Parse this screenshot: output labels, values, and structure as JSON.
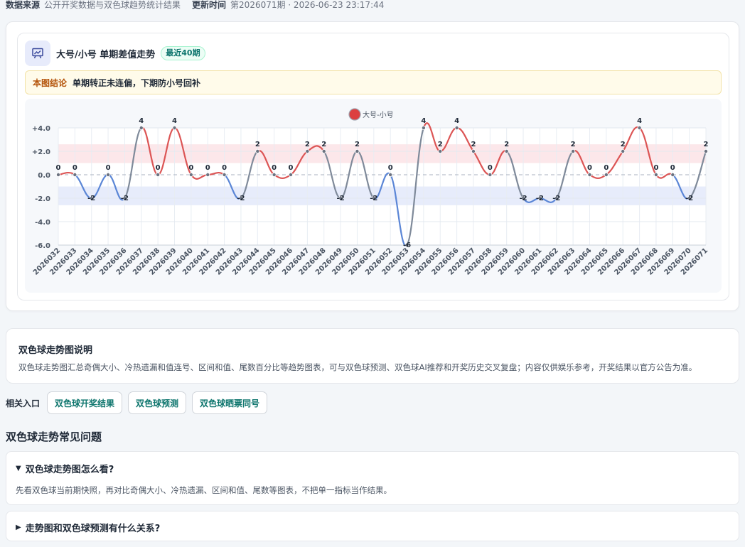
{
  "meta": {
    "source_label": "数据来源",
    "source_value": "公开开奖数据与双色球趋势统计结果",
    "update_label": "更新时间",
    "update_value": "第2026071期 · 2026-06-23 23:17:44"
  },
  "chart_card": {
    "title": "大号/小号 单期差值走势",
    "badge": "最近40期",
    "conclusion_tag": "本图结论",
    "conclusion_text": "单期转正未连偏，下期防小号回补"
  },
  "colors": {
    "positive": "#dc5555",
    "negative": "#5b86d6",
    "neutral": "#7f8a9a",
    "band_positive": "#fbe3e6",
    "band_negative": "#e3e9fa",
    "legend_dot": "#dc4040"
  },
  "chart_data": {
    "type": "line",
    "title": "",
    "legend": "大号-小号",
    "legend_position": "top-center",
    "x": [
      "2026032",
      "2026033",
      "2026034",
      "2026035",
      "2026036",
      "2026037",
      "2026038",
      "2026039",
      "2026040",
      "2026041",
      "2026042",
      "2026043",
      "2026044",
      "2026045",
      "2026046",
      "2026047",
      "2026048",
      "2026049",
      "2026050",
      "2026051",
      "2026052",
      "2026053",
      "2026054",
      "2026055",
      "2026056",
      "2026057",
      "2026058",
      "2026059",
      "2026060",
      "2026061",
      "2026062",
      "2026063",
      "2026064",
      "2026065",
      "2026066",
      "2026067",
      "2026068",
      "2026069",
      "2026070",
      "2026071"
    ],
    "series": [
      {
        "name": "大号-小号",
        "values": [
          0,
          0,
          -2,
          0,
          -2,
          4,
          0,
          4,
          0,
          0,
          0,
          -2,
          2,
          0,
          0,
          2,
          2,
          -2,
          2,
          -2,
          0,
          -6,
          4,
          2,
          4,
          2,
          0,
          2,
          -2,
          -2,
          -2,
          2,
          0,
          0,
          2,
          4,
          0,
          0,
          -2,
          2
        ]
      }
    ],
    "ylim": [
      -6,
      4
    ],
    "yticks": [
      "+4.0",
      "+2.0",
      "0.0",
      "-2.0",
      "-4.0",
      "-6.0"
    ],
    "ytick_values": [
      4,
      2,
      0,
      -2,
      -4,
      -6
    ],
    "bands": [
      {
        "from": 1,
        "to": 2.6,
        "tone": "positive"
      },
      {
        "from": -2.6,
        "to": -1,
        "tone": "negative"
      }
    ],
    "grid": true
  },
  "info": {
    "title": "双色球走势图说明",
    "desc": "双色球走势图汇总奇偶大小、冷热遗漏和值连号、区间和值、尾数百分比等趋势图表，可与双色球预测、双色球AI推荐和开奖历史交叉复盘；内容仅供娱乐参考，开奖结果以官方公告为准。"
  },
  "related": {
    "label": "相关入口",
    "links": [
      "双色球开奖结果",
      "双色球预测",
      "双色球晒票同号"
    ]
  },
  "faq": {
    "title": "双色球走势常见问题",
    "items": [
      {
        "arrow": "▼",
        "q": "双色球走势图怎么看?",
        "a": "先看双色球当前期快照，再对比奇偶大小、冷热遗漏、区间和值、尾数等图表，不把单一指标当作结果。"
      },
      {
        "arrow": "▶",
        "q": "走势图和双色球预测有什么关系?"
      }
    ]
  }
}
